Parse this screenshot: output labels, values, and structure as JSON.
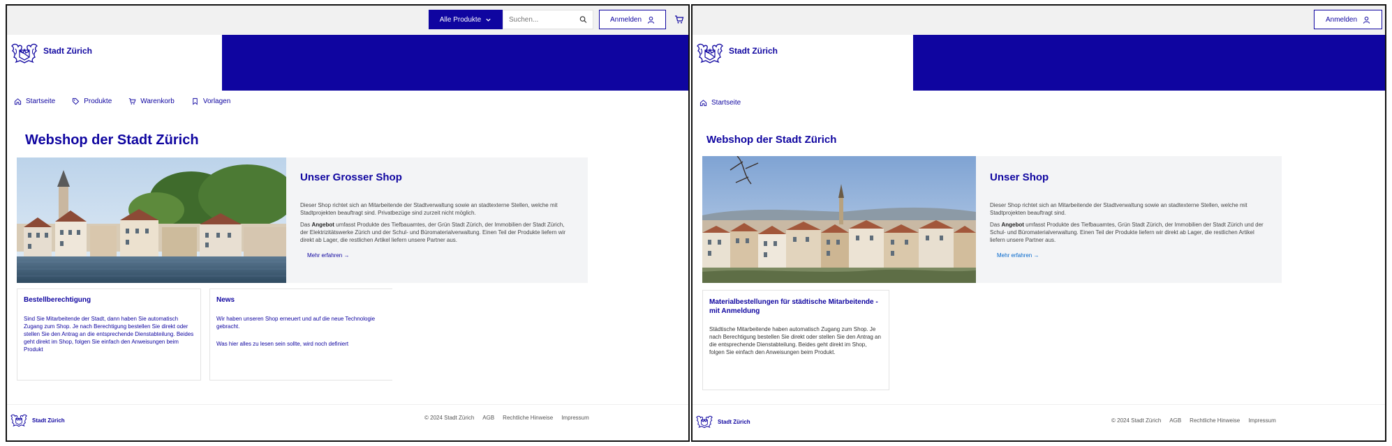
{
  "brand": {
    "name": "Stadt Zürich"
  },
  "header": {
    "category_button": "Alle Produkte",
    "search_placeholder": "Suchen...",
    "login_button": "Anmelden"
  },
  "nav": {
    "home": "Startseite",
    "products": "Produkte",
    "cart": "Warenkorb",
    "templates": "Vorlagen"
  },
  "left": {
    "page_title": "Webshop der Stadt Zürich",
    "hero": {
      "title": "Unser Grosser Shop",
      "p1": "Dieser Shop richtet sich an Mitarbeitende der Stadtverwaltung sowie an stadtexterne Stellen, welche mit Stadtprojekten beauftragt sind. Privatbezüge sind zurzeit nicht möglich.",
      "p2_bold": "Angebot",
      "p2_pre": "Das ",
      "p2_post": " umfasst Produkte des Tiefbauamtes, der Grün Stadt Zürich, der Immobilien der Stadt Zürich, der Elektrizitätswerke Zürich und der Schul- und Büromaterialverwaltung. Einen Teil der Produkte liefern wir direkt ab Lager, die restlichen Artikel liefern unsere Partner aus.",
      "link": "Mehr erfahren →"
    },
    "card1": {
      "title": "Bestellberechtigung",
      "text": "Sind Sie Mitarbeitende der Stadt, dann haben Sie automatisch Zugang zum Shop. Je nach Berechtigung bestellen Sie direkt oder stellen Sie den Antrag an die entsprechende Dienstabteilung. Beides geht direkt im Shop, folgen Sie einfach den Anweisungen beim Produkt"
    },
    "card2": {
      "title": "News",
      "text1": "Wir haben unseren Shop erneuert und auf die neue Technologie gebracht.",
      "text2": "Was hier alles zu lesen sein sollte, wird noch definiert"
    }
  },
  "right": {
    "page_title": "Webshop der Stadt Zürich",
    "hero": {
      "title": "Unser Shop",
      "p1": "Dieser Shop richtet sich an Mitarbeitende der Stadtverwaltung sowie an stadtexterne Stellen, welche mit Stadtprojekten beauftragt sind.",
      "p2_pre": "Das ",
      "p2_bold": "Angebot",
      "p2_post": " umfasst Produkte des Tiefbauamtes, Grün Stadt Zürich, der Immobilien der Stadt Zürich und der Schul- und Büromaterialverwaltung. Einen Teil der Produkte liefern wir direkt ab Lager, die restlichen Artikel liefern unsere Partner aus.",
      "link": "Mehr erfahren →"
    },
    "card1": {
      "title": "Materialbestellungen für städtische Mitarbeitende - mit Anmeldung",
      "text": "Städtische Mitarbeitende haben automatisch Zugang zum Shop. Je nach Berechtigung bestellen Sie direkt oder stellen Sie den Antrag an die entsprechende Dienstabteilung. Beides geht direkt im Shop, folgen Sie einfach den Anweisungen beim Produkt."
    }
  },
  "footer": {
    "copyright": "© 2024 Stadt Zürich",
    "agb": "AGB",
    "legal": "Rechtliche Hinweise",
    "imprint": "Impressum"
  },
  "colors": {
    "brand_blue": "#0f05a0",
    "link_blue": "#0066cc"
  }
}
